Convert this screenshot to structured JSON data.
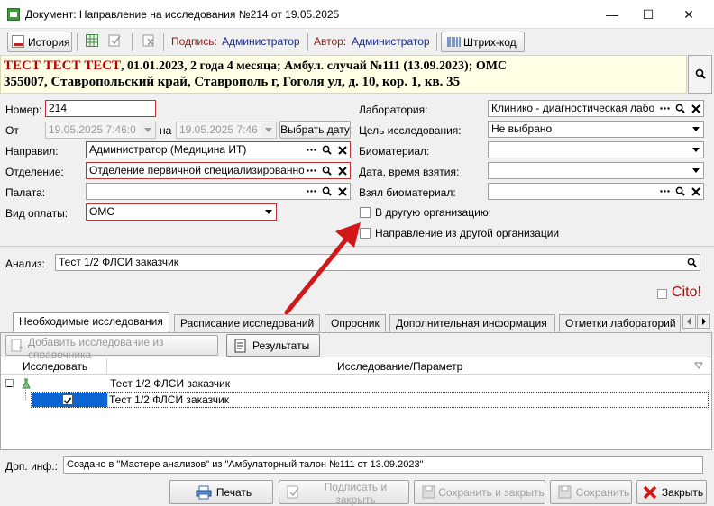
{
  "window": {
    "title": "Документ: Направление на исследования №214 от 19.05.2025",
    "minimize": "—",
    "maximize": "☐",
    "close": "✕"
  },
  "toolbar": {
    "history_label": "История",
    "signed_by_label": "Подпись:",
    "signed_by_value": "Администратор",
    "author_label": "Автор:",
    "author_value": "Администратор",
    "barcode_label": "Штрих-код"
  },
  "patient": {
    "name": "ТЕСТ ТЕСТ ТЕСТ",
    "details": ", 01.01.2023, 2 года 4 месяца; Амбул. случай №111 (13.09.2023); ОМС",
    "address": "355007, Ставропольский край, Ставрополь г, Гоголя ул, д. 10, кор. 1, кв. 35"
  },
  "form": {
    "number_label": "Номер:",
    "number_value": "214",
    "from_label": "От",
    "from_value": "19.05.2025 7:46:0",
    "to_label": "на",
    "to_value": "19.05.2025 7:46",
    "choose_date": "Выбрать дату",
    "referrer_label": "Направил:",
    "referrer_value": "Администратор (Медицина ИТ)",
    "department_label": "Отделение:",
    "department_value": "Отделение первичной специализированно",
    "ward_label": "Палата:",
    "ward_value": "",
    "payment_label": "Вид оплаты:",
    "payment_value": "ОМС",
    "lab_label": "Лаборатория:",
    "lab_value": "Клинико - диагностическая лабо",
    "goal_label": "Цель исследования:",
    "goal_value": "Не выбрано",
    "biomaterial_label": "Биоматериал:",
    "biomaterial_value": "",
    "datetime_label": "Дата, время взятия:",
    "datetime_value": "",
    "taker_label": "Взял биоматериал:",
    "taker_value": "",
    "other_org_label": "В другую организацию:",
    "from_other_org_label": "Направление из другой организации",
    "analysis_label": "Анализ:",
    "analysis_value": "Тест 1/2 ФЛСИ заказчик",
    "cito_label": "Cito!"
  },
  "tabs": [
    {
      "label": "Необходимые исследования"
    },
    {
      "label": "Расписание исследований"
    },
    {
      "label": "Опросник"
    },
    {
      "label": "Дополнительная информация"
    },
    {
      "label": "Отметки лабораторий"
    }
  ],
  "panel": {
    "add_from_ref": "Добавить исследование из справочника",
    "results": "Результаты",
    "col_investigate": "Исследовать",
    "col_param": "Исследование/Параметр",
    "rows": [
      {
        "label": "Тест 1/2 ФЛСИ заказчик"
      },
      {
        "label": "Тест 1/2 ФЛСИ заказчик"
      }
    ]
  },
  "extra": {
    "label": "Доп. инф.:",
    "value": "Создано в \"Мастере анализов\" из \"Амбулаторный талон №111 от 13.09.2023\""
  },
  "footer": {
    "print": "Печать",
    "sign_close": "Подписать и закрыть",
    "save_close": "Сохранить и закрыть",
    "save": "Сохранить",
    "close": "Закрыть"
  },
  "colors": {
    "accent_red": "#d01818",
    "required_border": "#c03030",
    "patient_bg": "#ffffe6",
    "selection": "#0a64d2"
  }
}
